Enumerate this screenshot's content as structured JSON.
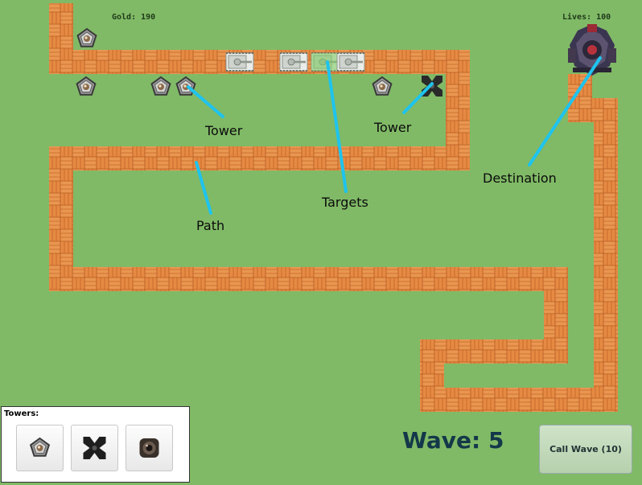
{
  "hud": {
    "gold": "Gold: 190",
    "lives": "Lives: 100"
  },
  "annotations": {
    "tower_left": "Tower",
    "tower_right": "Tower",
    "targets": "Targets",
    "path": "Path",
    "destination": "Destination"
  },
  "tower_panel": {
    "title": "Towers:",
    "towers": [
      {
        "icon": "pentagon-tower-icon"
      },
      {
        "icon": "cross-tower-icon"
      },
      {
        "icon": "cannon-tower-icon"
      }
    ]
  },
  "wave_label": "Wave: 5",
  "call_wave_label": "Call Wave (10)",
  "colors": {
    "grass": "#80ba66",
    "path": "#e48a42",
    "annotation": "#1ec3ee",
    "wave_text": "#14384a"
  }
}
